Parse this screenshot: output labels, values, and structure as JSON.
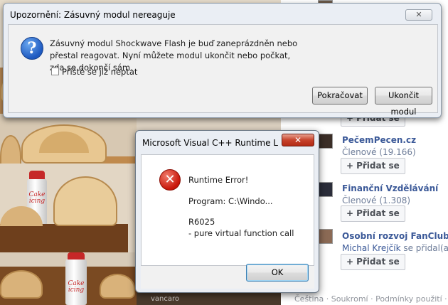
{
  "warning_dialog": {
    "title": "Upozornění: Zásuvný modul nereaguje",
    "close_label": "✕",
    "message": "Zásuvný modul Shockwave Flash je buď zaneprázdněn nebo přestal reagovat. Nyní můžete modul ukončit nebo počkat, zda se dokončí sám.",
    "checkbox_label": "Příště se již neptat",
    "checkbox_checked": false,
    "continue_button": "Pokračovat",
    "stop_button": "Ukončit modul",
    "icon": "question-icon"
  },
  "runtime_dialog": {
    "title": "Microsoft Visual C++ Runtime Libr...",
    "close_label": "✕",
    "icon": "error-icon",
    "heading": "Runtime Error!",
    "program": "Program: C:\\Windo...",
    "code": "R6025",
    "detail": "- pure virtual function call",
    "ok_button": "OK"
  },
  "facebook_sidebar": {
    "items": [
      {
        "name": "PečemPecen.cz",
        "members": "Členové (19.166)",
        "add_button": "Přidat se"
      },
      {
        "name": "Finanční Vzdělávání",
        "members": "Členové (1.308)",
        "add_button": "Přidat se"
      },
      {
        "name": "Osobní rozvoj FanClub",
        "activity_user": "Michal Krejčík",
        "activity_text": " se přidal(a).",
        "add_button": "Přidat se"
      }
    ],
    "partial_add_button": "Přidat se",
    "footer": "Čeština · Soukromí · Podmínky použití ·"
  },
  "photo_grid": {
    "can_label_1": "Cake icing",
    "can_label_2": "Cake icing",
    "watermark": "vancaro"
  },
  "colors": {
    "facebook_link": "#3b5998",
    "error_red": "#c8160a",
    "question_blue": "#1d59c0"
  }
}
